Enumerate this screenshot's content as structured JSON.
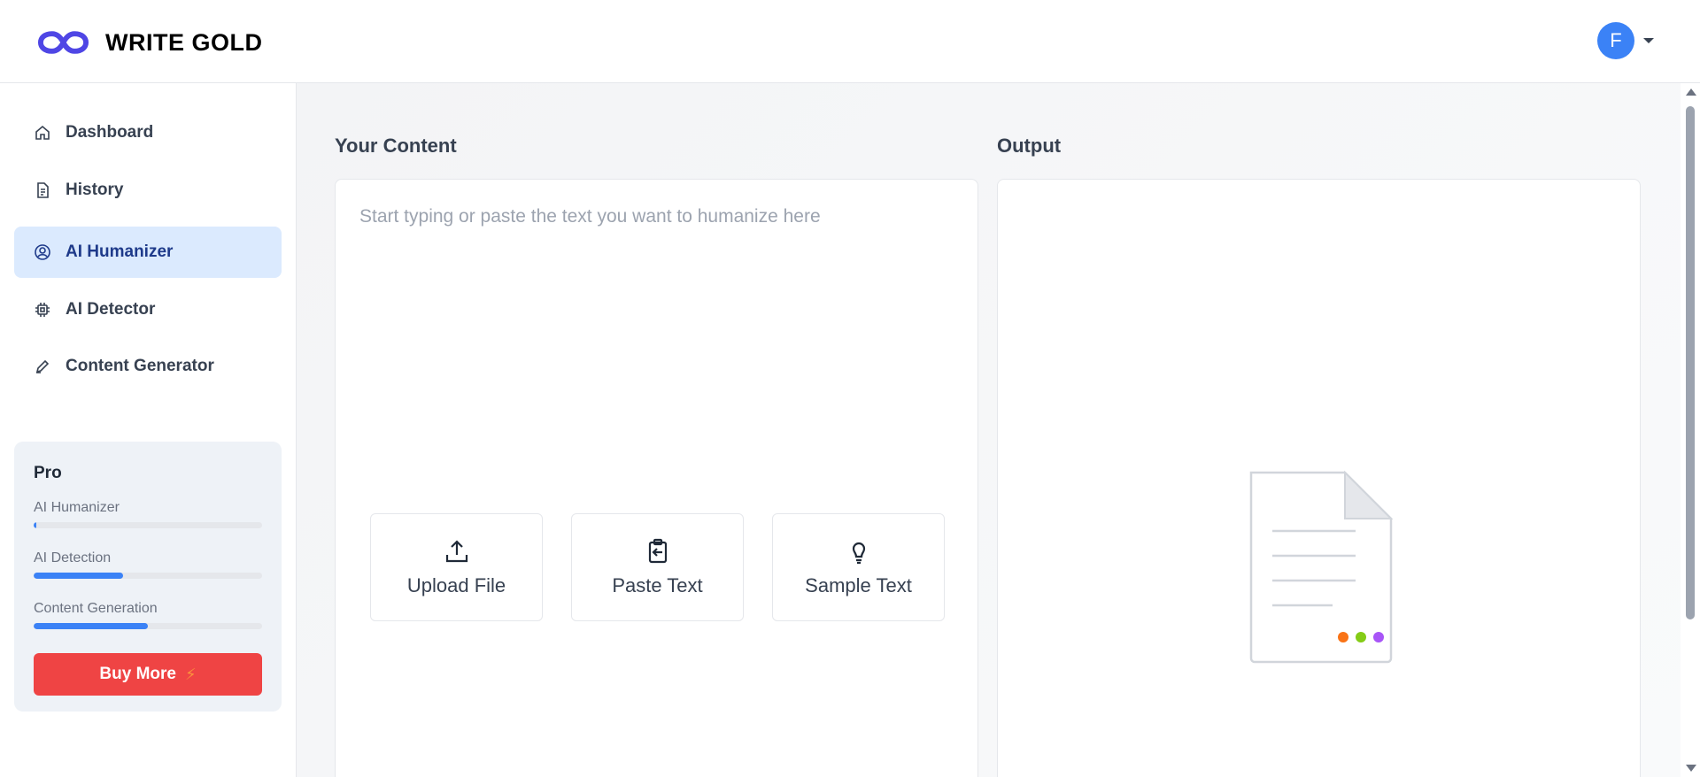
{
  "app": {
    "brand": "WRITE GOLD",
    "brand_color": "#4f46e5"
  },
  "user": {
    "initial": "F",
    "avatar_color": "#3b82f6"
  },
  "sidebar": {
    "items": [
      {
        "label": "Dashboard",
        "icon": "home-icon"
      },
      {
        "label": "History",
        "icon": "document-icon"
      },
      {
        "label": "AI Humanizer",
        "icon": "user-circle-icon",
        "active": true
      },
      {
        "label": "AI Detector",
        "icon": "chip-icon"
      },
      {
        "label": "Content Generator",
        "icon": "pencil-icon"
      }
    ],
    "plan": {
      "title": "Pro",
      "usage": [
        {
          "label": "AI Humanizer",
          "progress": 0.01
        },
        {
          "label": "AI Detection",
          "progress": 0.39
        },
        {
          "label": "Content Generation",
          "progress": 0.5
        }
      ],
      "buy_label": "Buy More",
      "buy_color": "#ef4444"
    }
  },
  "content": {
    "title": "Your Content",
    "placeholder": "Start typing or paste the text you want to humanize here",
    "actions": [
      {
        "label": "Upload File",
        "icon": "upload-icon"
      },
      {
        "label": "Paste Text",
        "icon": "clipboard-icon"
      },
      {
        "label": "Sample Text",
        "icon": "lightbulb-icon"
      }
    ]
  },
  "output": {
    "title": "Output",
    "illustration": "document-illustration-icon",
    "dot_colors": [
      "#f97316",
      "#84cc16",
      "#a855f7"
    ]
  }
}
